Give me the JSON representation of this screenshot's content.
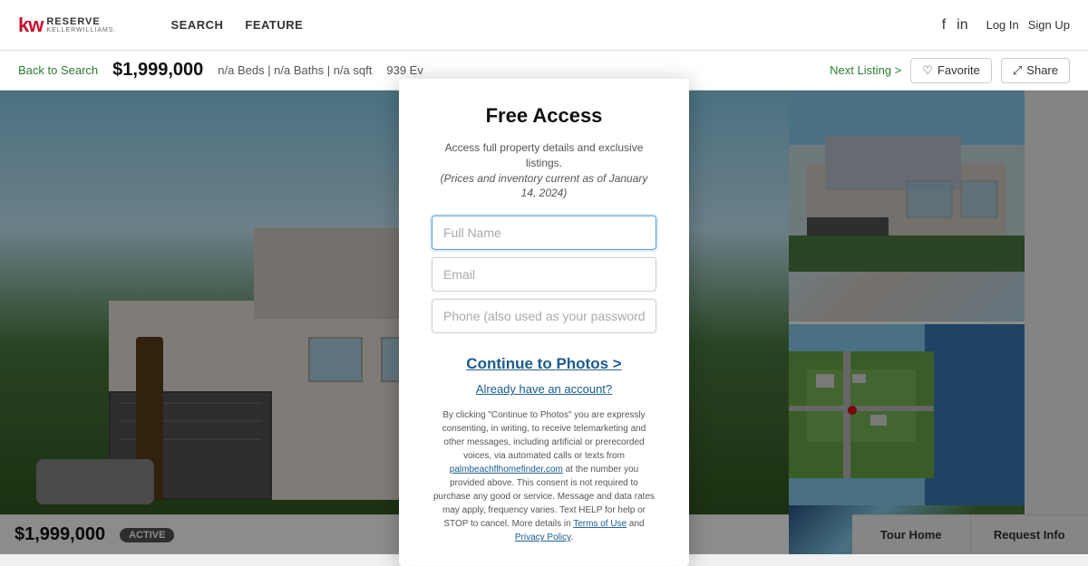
{
  "header": {
    "logo_kw": "kw",
    "logo_reserve": "RESERVE",
    "logo_sub": "KELLERWILLIAMS.",
    "nav_items": [
      "SEARCH",
      "FEATURE"
    ],
    "social_fb": "f",
    "social_in": "in",
    "log_in": "Log In",
    "sign_up": "Sign Up"
  },
  "listing_bar": {
    "back_label": "Back to Search",
    "price": "$1,999,000",
    "beds_baths": "n/a Beds | n/a Baths | n/a sqft",
    "address": "939 Ev",
    "next_listing": "Next Listing >",
    "favorite_label": "Favorite",
    "share_label": "Share"
  },
  "modal": {
    "title": "Free Access",
    "subtitle_line1": "Access full property details and exclusive listings.",
    "subtitle_line2": "(Prices and inventory current as of January 14, 2024)",
    "full_name_placeholder": "Full Name",
    "email_placeholder": "Email",
    "phone_placeholder": "Phone (also used as your password)",
    "cta_label": "Continue to Photos >",
    "account_label": "Already have an account?",
    "disclaimer": "By clicking \"Continue to Photos\" you are expressly consenting, in writing, to receive telemarketing and other messages, including artificial or prerecorded voices, via automated calls or texts from ",
    "disclaimer_link": "palmbeachflhomefinder.com",
    "disclaimer2": " at the number you provided above. This consent is not required to purchase any good or service. Message and data rates may apply, frequency varies. Text HELP for help or STOP to cancel. More details in ",
    "terms_label": "Terms of Use",
    "and": " and ",
    "privacy_label": "Privacy Policy",
    "disclaimer3": "."
  },
  "bottom": {
    "price": "$1,999,000",
    "active_badge": "ACTIVE",
    "tour_home": "Tour Home",
    "request_info": "Request Info"
  },
  "icons": {
    "heart": "♡",
    "share": "⤢",
    "camera": "📷",
    "location": "📍",
    "play": "▶"
  }
}
